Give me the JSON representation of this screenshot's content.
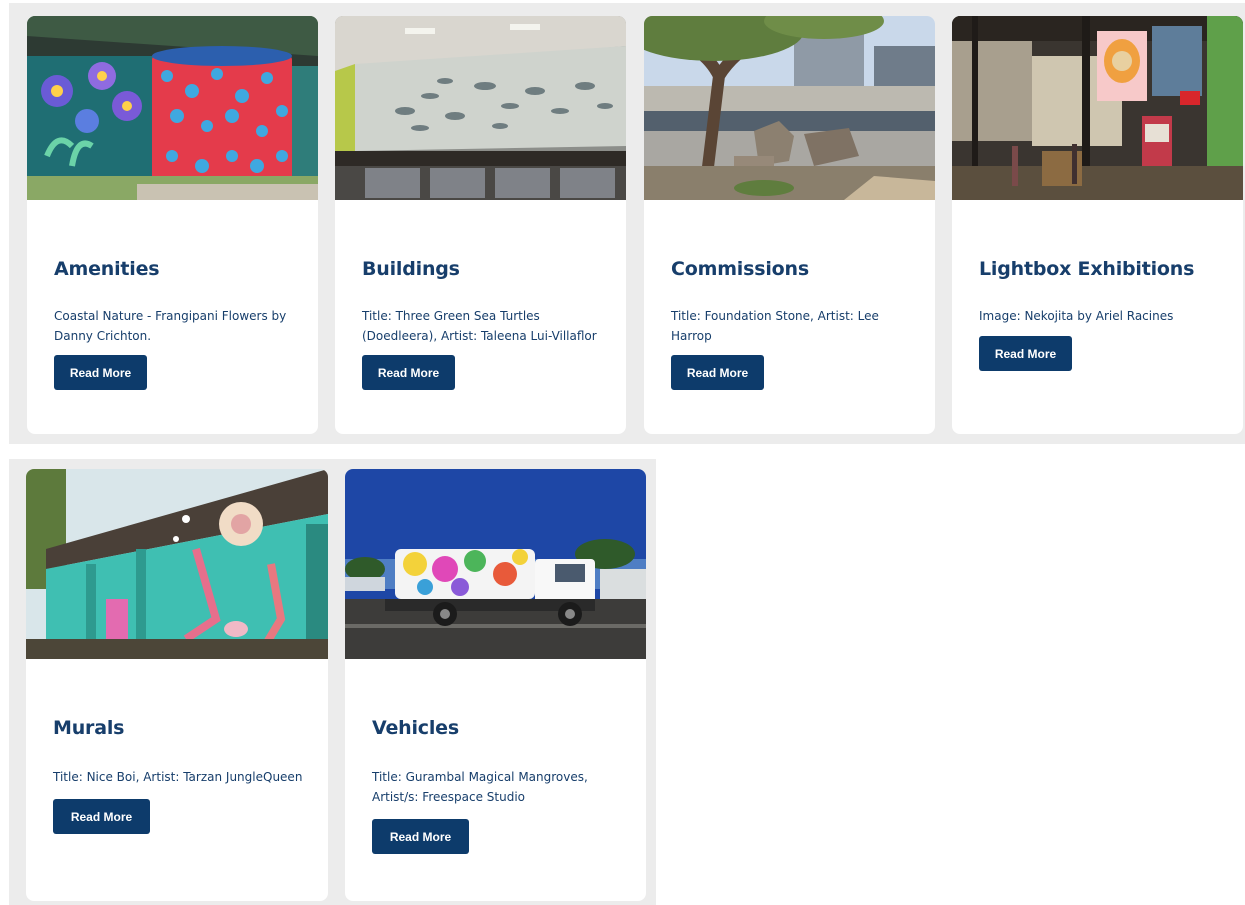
{
  "cards": [
    {
      "title": "Amenities",
      "description": "Coastal Nature - Frangipani Flowers by Danny Crichton.",
      "button_label": "Read More",
      "image": "painted-water-tank-flowers-mural"
    },
    {
      "title": "Buildings",
      "description": "Title: Three Green Sea Turtles (Doedleera), Artist: Taleena Lui-Villaflor",
      "button_label": "Read More",
      "image": "sea-turtles-wall-artwork"
    },
    {
      "title": "Commissions",
      "description": "Title: Foundation Stone, Artist: Lee Harrop",
      "button_label": "Read More",
      "image": "stone-sculptures-under-tree"
    },
    {
      "title": "Lightbox Exhibitions",
      "description": "Image: Nekojita by Ariel Racines",
      "button_label": "Read More",
      "image": "street-lightbox-artwork"
    },
    {
      "title": "Murals",
      "description": "Title: Nice Boi, Artist: Tarzan JungleQueen",
      "button_label": "Read More",
      "image": "teal-wall-mural"
    },
    {
      "title": "Vehicles",
      "description": "Title: Gurambal Magical Mangroves, Artist/s: Freespace Studio",
      "button_label": "Read More",
      "image": "painted-street-sweeper-truck"
    }
  ],
  "colors": {
    "title": "#173e6b",
    "button": "#0d3b6b",
    "row_background": "#ececec"
  }
}
